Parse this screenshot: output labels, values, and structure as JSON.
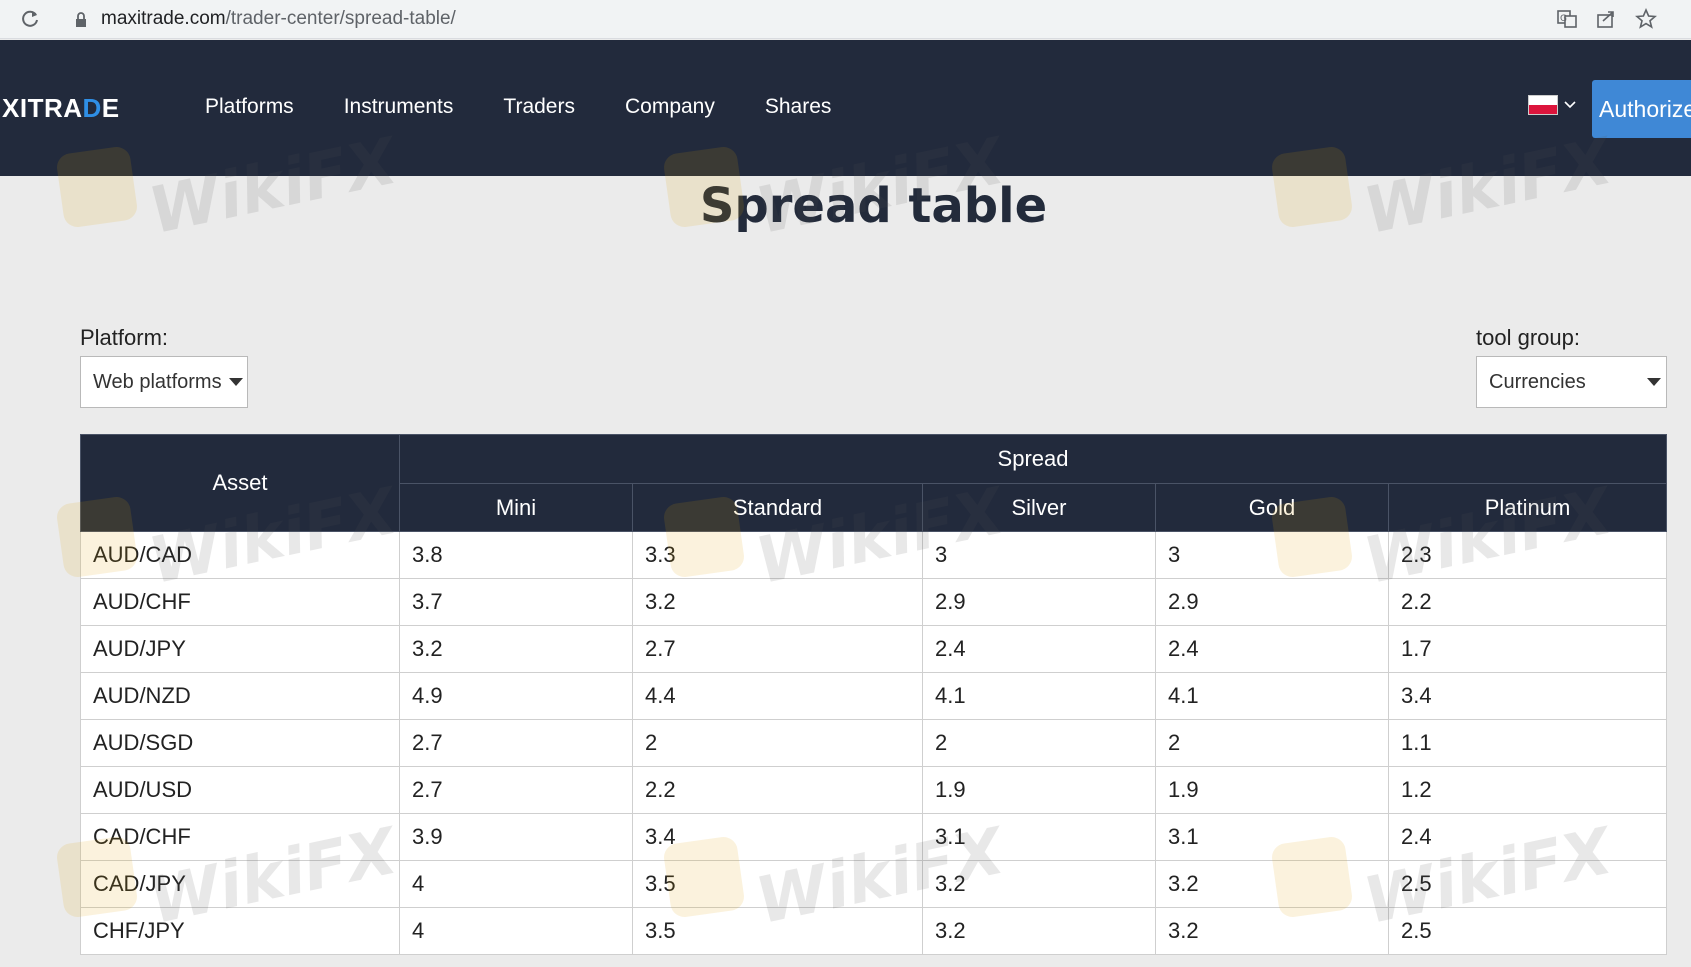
{
  "browser": {
    "url_domain": "maxitrade.com",
    "url_path": "/trader-center/spread-table/",
    "icons": [
      "reload-icon",
      "lock-icon",
      "translate-icon",
      "share-icon",
      "star-icon"
    ]
  },
  "header": {
    "logo_main": "XITRA",
    "logo_accent": "D",
    "logo_end": "E",
    "nav": [
      "Platforms",
      "Instruments",
      "Traders",
      "Company",
      "Shares"
    ],
    "language_flag": "poland-flag",
    "authorize_label": "Authorize"
  },
  "page": {
    "title": "Spread table"
  },
  "filters": {
    "platform_label": "Platform:",
    "platform_value": "Web platforms",
    "tool_group_label": "tool group:",
    "tool_group_value": "Currencies"
  },
  "table": {
    "asset_header": "Asset",
    "spread_header": "Spread",
    "columns": [
      "Mini",
      "Standard",
      "Silver",
      "Gold",
      "Platinum"
    ],
    "rows": [
      {
        "asset": "AUD/CAD",
        "values": [
          "3.8",
          "3.3",
          "3",
          "3",
          "2.3"
        ]
      },
      {
        "asset": "AUD/CHF",
        "values": [
          "3.7",
          "3.2",
          "2.9",
          "2.9",
          "2.2"
        ]
      },
      {
        "asset": "AUD/JPY",
        "values": [
          "3.2",
          "2.7",
          "2.4",
          "2.4",
          "1.7"
        ]
      },
      {
        "asset": "AUD/NZD",
        "values": [
          "4.9",
          "4.4",
          "4.1",
          "4.1",
          "3.4"
        ]
      },
      {
        "asset": "AUD/SGD",
        "values": [
          "2.7",
          "2",
          "2",
          "2",
          "1.1"
        ]
      },
      {
        "asset": "AUD/USD",
        "values": [
          "2.7",
          "2.2",
          "1.9",
          "1.9",
          "1.2"
        ]
      },
      {
        "asset": "CAD/CHF",
        "values": [
          "3.9",
          "3.4",
          "3.1",
          "3.1",
          "2.4"
        ]
      },
      {
        "asset": "CAD/JPY",
        "values": [
          "4",
          "3.5",
          "3.2",
          "3.2",
          "2.5"
        ]
      },
      {
        "asset": "CHF/JPY",
        "values": [
          "4",
          "3.5",
          "3.2",
          "3.2",
          "2.5"
        ]
      }
    ]
  },
  "watermark": {
    "text": "WikiFX"
  },
  "colors": {
    "header_bg": "#222a3c",
    "accent_blue": "#3f88d6",
    "page_bg": "#ebebeb"
  }
}
